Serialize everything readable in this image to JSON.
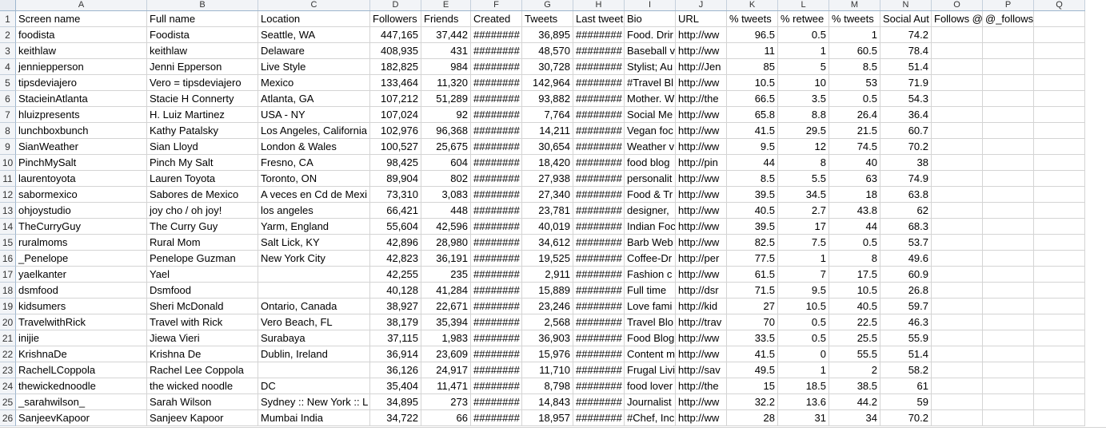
{
  "columns": [
    "A",
    "B",
    "C",
    "D",
    "E",
    "F",
    "G",
    "H",
    "I",
    "J",
    "K",
    "L",
    "M",
    "N",
    "O",
    "P",
    "Q"
  ],
  "header_row": [
    "Screen name",
    "Full name",
    "Location",
    "Followers",
    "Friends",
    "Created",
    "Tweets",
    "Last tweet",
    "Bio",
    "URL",
    "% tweets",
    "% retwee",
    "% tweets",
    "Social Aut",
    "Follows @",
    "@_follows",
    ""
  ],
  "rows": [
    [
      "foodista",
      "Foodista",
      "Seattle, WA",
      "447,165",
      "37,442",
      "########",
      "36,895",
      "########",
      "Food. Drir",
      "http://ww",
      "96.5",
      "0.5",
      "1",
      "74.2",
      "",
      "",
      ""
    ],
    [
      "keithlaw",
      "keithlaw",
      "Delaware",
      "408,935",
      "431",
      "########",
      "48,570",
      "########",
      "Baseball v",
      "http://ww",
      "11",
      "1",
      "60.5",
      "78.4",
      "",
      "",
      ""
    ],
    [
      "jenniepperson",
      "Jenni Epperson",
      "Live Style",
      "182,825",
      "984",
      "########",
      "30,728",
      "########",
      "Stylist; Au",
      "http://Jen",
      "85",
      "5",
      "8.5",
      "51.4",
      "",
      "",
      ""
    ],
    [
      "tipsdeviajero",
      "Vero = tipsdeviajero",
      "Mexico",
      "133,464",
      "11,320",
      "########",
      "142,964",
      "########",
      "#Travel Bl",
      "http://ww",
      "10.5",
      "10",
      "53",
      "71.9",
      "",
      "",
      ""
    ],
    [
      "StacieinAtlanta",
      "Stacie H Connerty",
      "Atlanta, GA",
      "107,212",
      "51,289",
      "########",
      "93,882",
      "########",
      "Mother. W",
      "http://the",
      "66.5",
      "3.5",
      "0.5",
      "54.3",
      "",
      "",
      ""
    ],
    [
      "hluizpresents",
      "H. Luiz Martinez",
      "USA - NY",
      "107,024",
      "92",
      "########",
      "7,764",
      "########",
      "Social Me",
      "http://ww",
      "65.8",
      "8.8",
      "26.4",
      "36.4",
      "",
      "",
      ""
    ],
    [
      "lunchboxbunch",
      "Kathy Patalsky",
      "Los Angeles, California",
      "102,976",
      "96,368",
      "########",
      "14,211",
      "########",
      "Vegan foc",
      "http://ww",
      "41.5",
      "29.5",
      "21.5",
      "60.7",
      "",
      "",
      ""
    ],
    [
      "SianWeather",
      "Sian Lloyd",
      "London & Wales",
      "100,527",
      "25,675",
      "########",
      "30,654",
      "########",
      "Weather v",
      "http://ww",
      "9.5",
      "12",
      "74.5",
      "70.2",
      "",
      "",
      ""
    ],
    [
      "PinchMySalt",
      "Pinch My Salt",
      "Fresno, CA",
      "98,425",
      "604",
      "########",
      "18,420",
      "########",
      "food blog",
      "http://pin",
      "44",
      "8",
      "40",
      "38",
      "",
      "",
      ""
    ],
    [
      "laurentoyota",
      "Lauren Toyota",
      "Toronto, ON",
      "89,904",
      "802",
      "########",
      "27,938",
      "########",
      "personalit",
      "http://ww",
      "8.5",
      "5.5",
      "63",
      "74.9",
      "",
      "",
      ""
    ],
    [
      "sabormexico",
      "Sabores de Mexico",
      "A veces en Cd de Mexi",
      "73,310",
      "3,083",
      "########",
      "27,340",
      "########",
      "Food & Tr",
      "http://ww",
      "39.5",
      "34.5",
      "18",
      "63.8",
      "",
      "",
      ""
    ],
    [
      "ohjoystudio",
      "joy cho / oh joy!",
      "los angeles",
      "66,421",
      "448",
      "########",
      "23,781",
      "########",
      "designer,",
      "http://ww",
      "40.5",
      "2.7",
      "43.8",
      "62",
      "",
      "",
      ""
    ],
    [
      "TheCurryGuy",
      "The Curry Guy",
      "Yarm, England",
      "55,604",
      "42,596",
      "########",
      "40,019",
      "########",
      "Indian Foc",
      "http://ww",
      "39.5",
      "17",
      "44",
      "68.3",
      "",
      "",
      ""
    ],
    [
      "ruralmoms",
      "Rural Mom",
      "Salt Lick, KY",
      "42,896",
      "28,980",
      "########",
      "34,612",
      "########",
      "Barb Web",
      "http://ww",
      "82.5",
      "7.5",
      "0.5",
      "53.7",
      "",
      "",
      ""
    ],
    [
      "_Penelope",
      "Penelope Guzman",
      "New York City",
      "42,823",
      "36,191",
      "########",
      "19,525",
      "########",
      "Coffee-Dr",
      "http://per",
      "77.5",
      "1",
      "8",
      "49.6",
      "",
      "",
      ""
    ],
    [
      "yaelkanter",
      "Yael",
      "",
      "42,255",
      "235",
      "########",
      "2,911",
      "########",
      "Fashion c",
      "http://ww",
      "61.5",
      "7",
      "17.5",
      "60.9",
      "",
      "",
      ""
    ],
    [
      "dsmfood",
      "Dsmfood",
      "",
      "40,128",
      "41,284",
      "########",
      "15,889",
      "########",
      "Full time",
      "http://dsr",
      "71.5",
      "9.5",
      "10.5",
      "26.8",
      "",
      "",
      ""
    ],
    [
      "kidsumers",
      "Sheri McDonald",
      "Ontario, Canada",
      "38,927",
      "22,671",
      "########",
      "23,246",
      "########",
      "Love fami",
      "http://kid",
      "27",
      "10.5",
      "40.5",
      "59.7",
      "",
      "",
      ""
    ],
    [
      "TravelwithRick",
      "Travel with Rick",
      "Vero Beach, FL",
      "38,179",
      "35,394",
      "########",
      "2,568",
      "########",
      "Travel Blo",
      "http://trav",
      "70",
      "0.5",
      "22.5",
      "46.3",
      "",
      "",
      ""
    ],
    [
      "inijie",
      "Jiewa Vieri",
      "Surabaya",
      "37,115",
      "1,983",
      "########",
      "36,903",
      "########",
      "Food Blog",
      "http://ww",
      "33.5",
      "0.5",
      "25.5",
      "55.9",
      "",
      "",
      ""
    ],
    [
      "KrishnaDe",
      "Krishna De",
      "Dublin, Ireland",
      "36,914",
      "23,609",
      "########",
      "15,976",
      "########",
      "Content m",
      "http://ww",
      "41.5",
      "0",
      "55.5",
      "51.4",
      "",
      "",
      ""
    ],
    [
      "RachelLCoppola",
      "Rachel Lee Coppola",
      "",
      "36,126",
      "24,917",
      "########",
      "11,710",
      "########",
      "Frugal Livi",
      "http://sav",
      "49.5",
      "1",
      "2",
      "58.2",
      "",
      "",
      ""
    ],
    [
      "thewickednoodle",
      "the wicked noodle",
      "DC",
      "35,404",
      "11,471",
      "########",
      "8,798",
      "########",
      "food lover",
      "http://the",
      "15",
      "18.5",
      "38.5",
      "61",
      "",
      "",
      ""
    ],
    [
      "_sarahwilson_",
      "Sarah Wilson",
      "Sydney :: New York :: L",
      "34,895",
      "273",
      "########",
      "14,843",
      "########",
      "Journalist",
      "http://ww",
      "32.2",
      "13.6",
      "44.2",
      "59",
      "",
      "",
      ""
    ],
    [
      "SanjeevKapoor",
      "Sanjeev Kapoor",
      "Mumbai India",
      "34,722",
      "66",
      "########",
      "18,957",
      "########",
      "#Chef, Inc",
      "http://ww",
      "28",
      "31",
      "34",
      "70.2",
      "",
      "",
      ""
    ]
  ]
}
